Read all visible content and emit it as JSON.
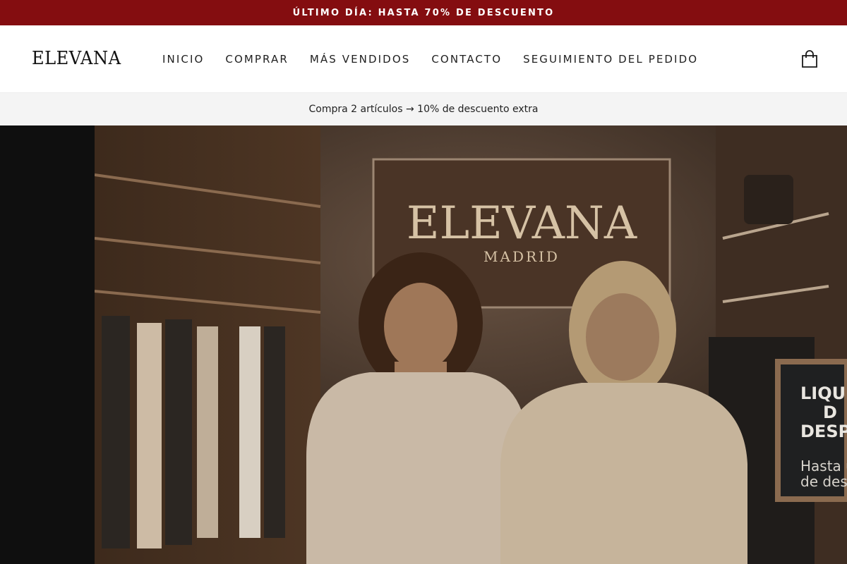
{
  "announcement": {
    "text": "ÚLTIMO DÍA: HASTA 70% DE DESCUENTO",
    "bg_color": "#840d10"
  },
  "header": {
    "logo": "ELEVANA",
    "nav": [
      {
        "label": "INICIO"
      },
      {
        "label": "COMPRAR"
      },
      {
        "label": "MÁS VENDIDOS"
      },
      {
        "label": "CONTACTO"
      },
      {
        "label": "SEGUIMIENTO DEL PEDIDO"
      }
    ],
    "cart_icon": "shopping-bag-icon"
  },
  "promo": {
    "text": "Compra 2 artículos → 10% de descuento extra"
  },
  "hero": {
    "store_sign": {
      "brand": "ELEVANA",
      "city": "MADRID"
    },
    "chalkboard": {
      "line1": "LIQUID",
      "line2": "D",
      "line3": "DESPE",
      "line4": "Hasta u",
      "line5": "de desc"
    }
  }
}
